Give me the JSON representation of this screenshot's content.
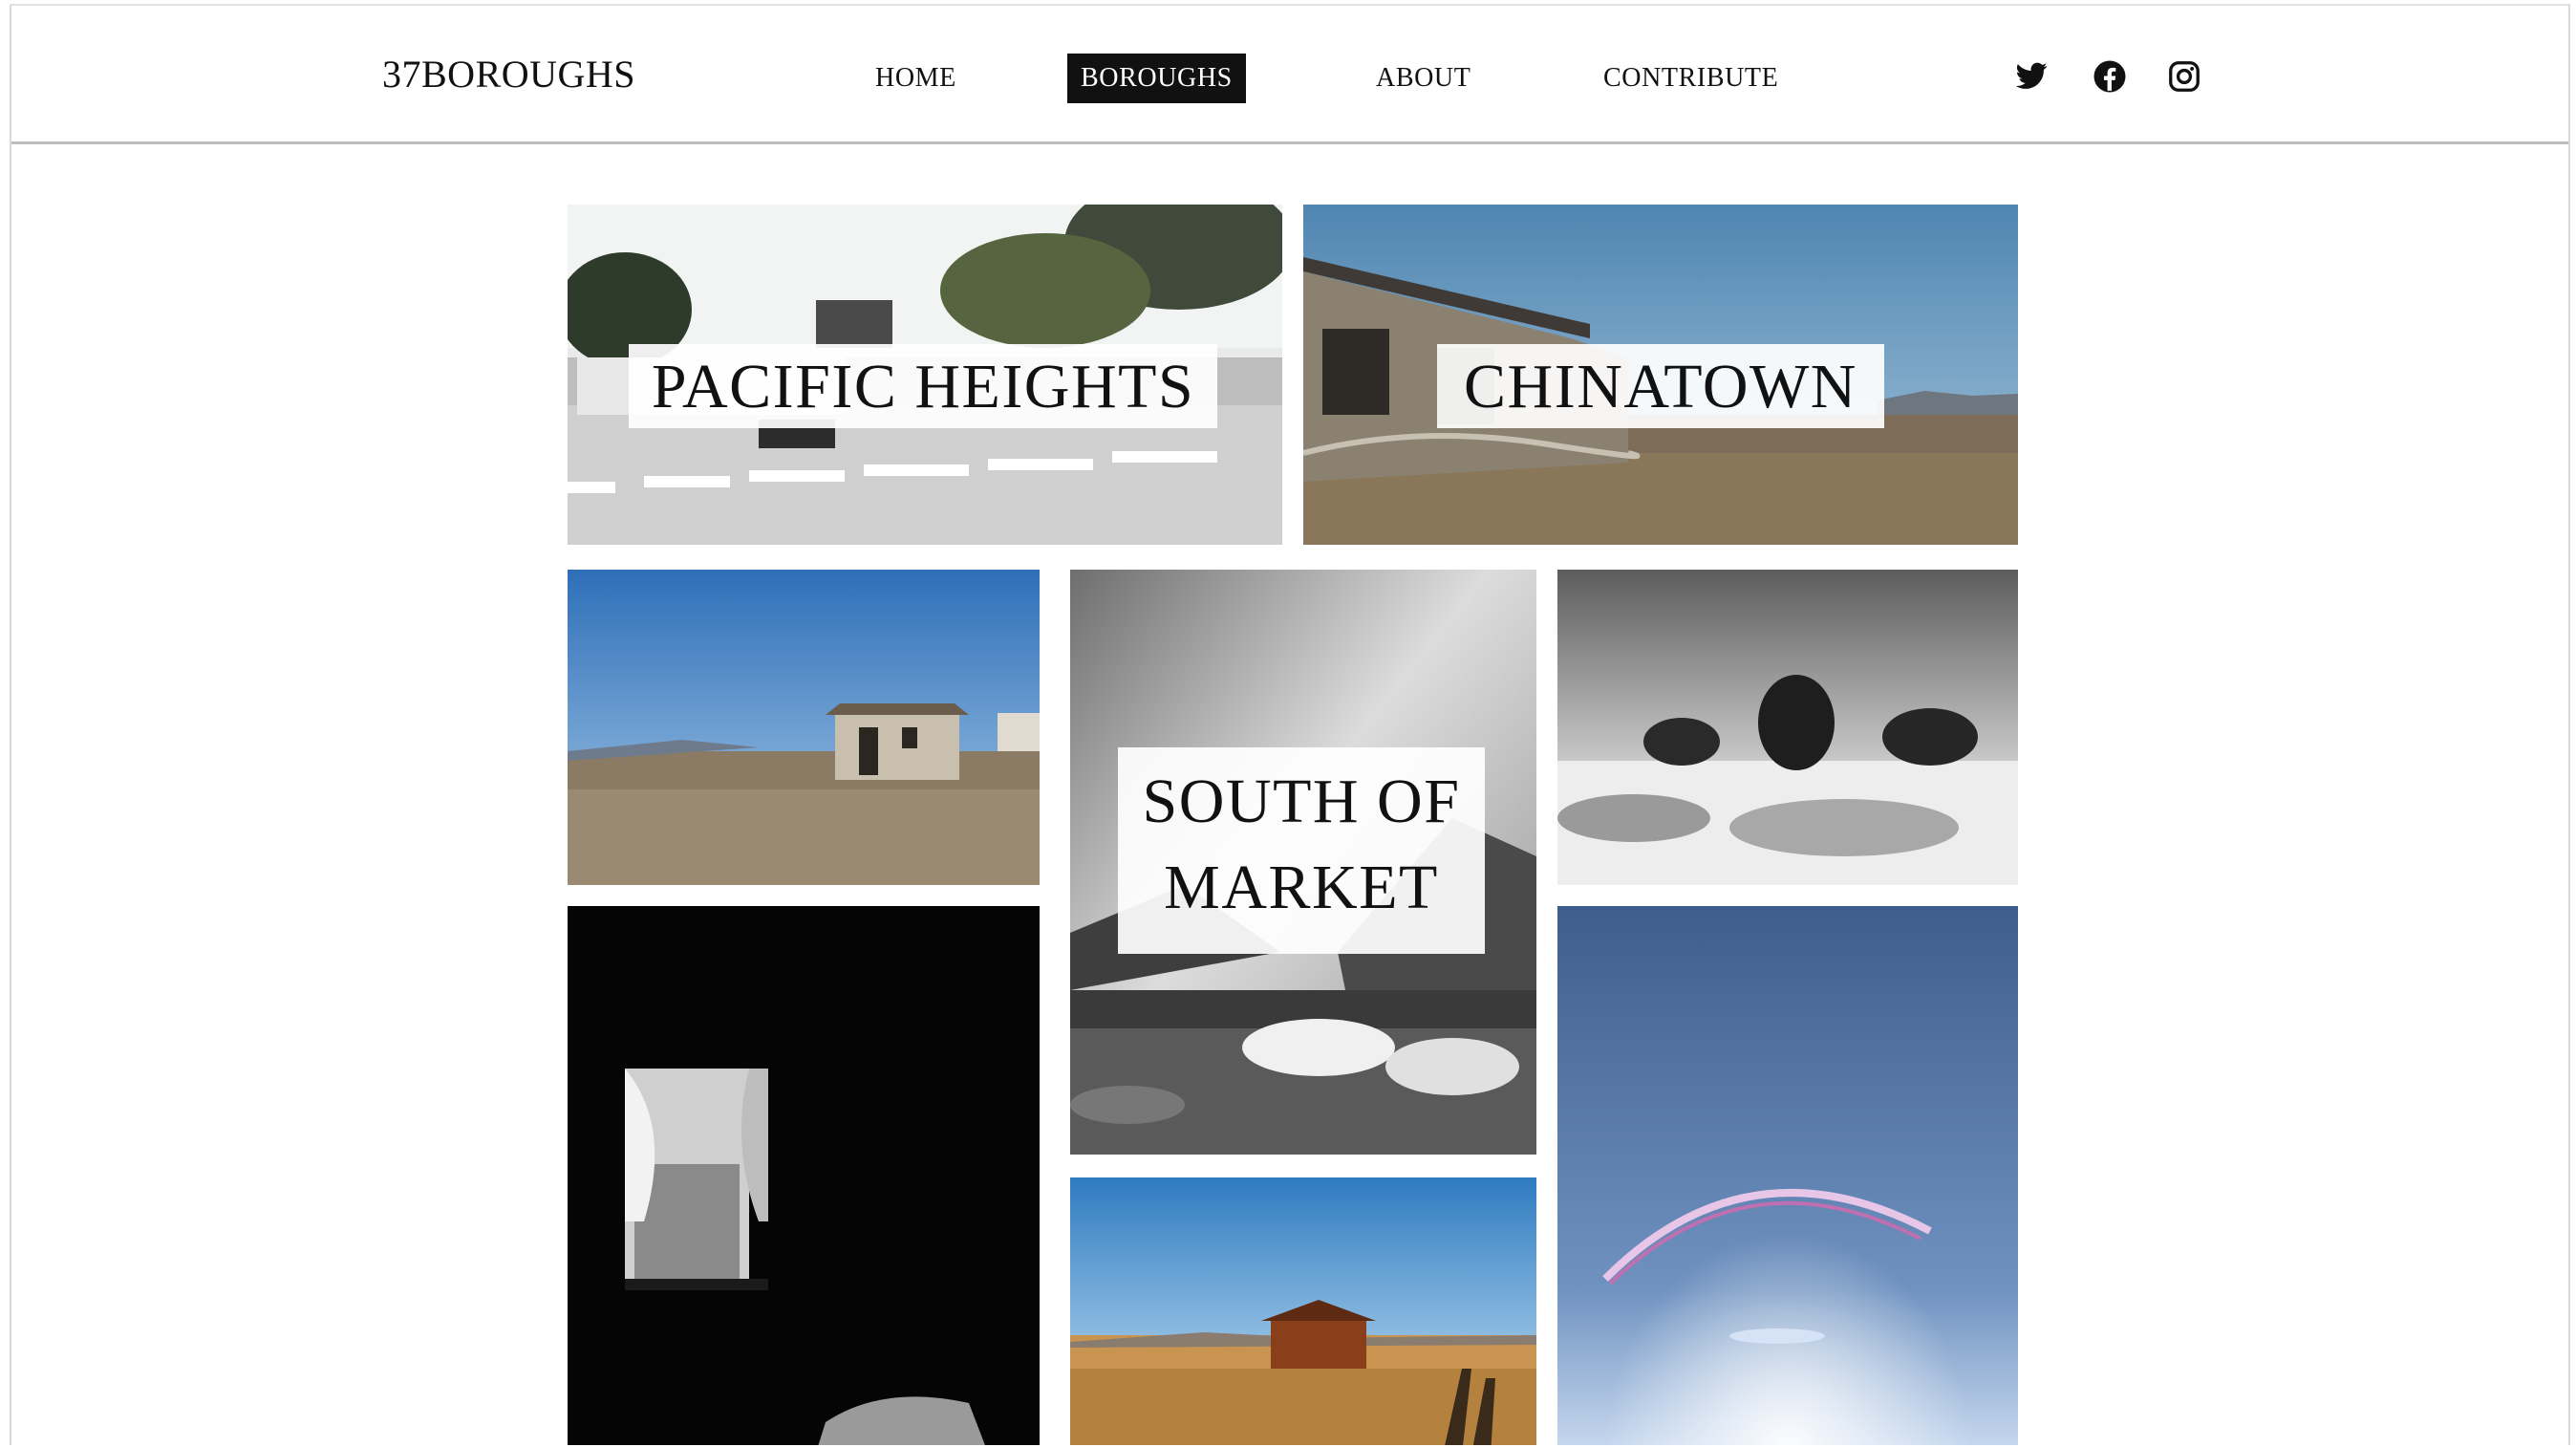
{
  "site": {
    "logo": "37BOROUGHS"
  },
  "nav": {
    "items": [
      {
        "label": "HOME",
        "active": false
      },
      {
        "label": "BOROUGHS",
        "active": true
      },
      {
        "label": "ABOUT",
        "active": false
      },
      {
        "label": "CONTRIBUTE",
        "active": false
      }
    ]
  },
  "social": [
    "twitter-icon",
    "facebook-icon",
    "instagram-icon"
  ],
  "tiles": {
    "pacific_heights": {
      "label": "PACIFIC HEIGHTS"
    },
    "chinatown": {
      "label": "CHINATOWN"
    },
    "south_of_market": {
      "line1": "SOUTH OF",
      "line2": "MARKET"
    }
  },
  "colors": {
    "accent": "#111111",
    "background": "#ffffff",
    "divider": "#bdbdbd"
  }
}
